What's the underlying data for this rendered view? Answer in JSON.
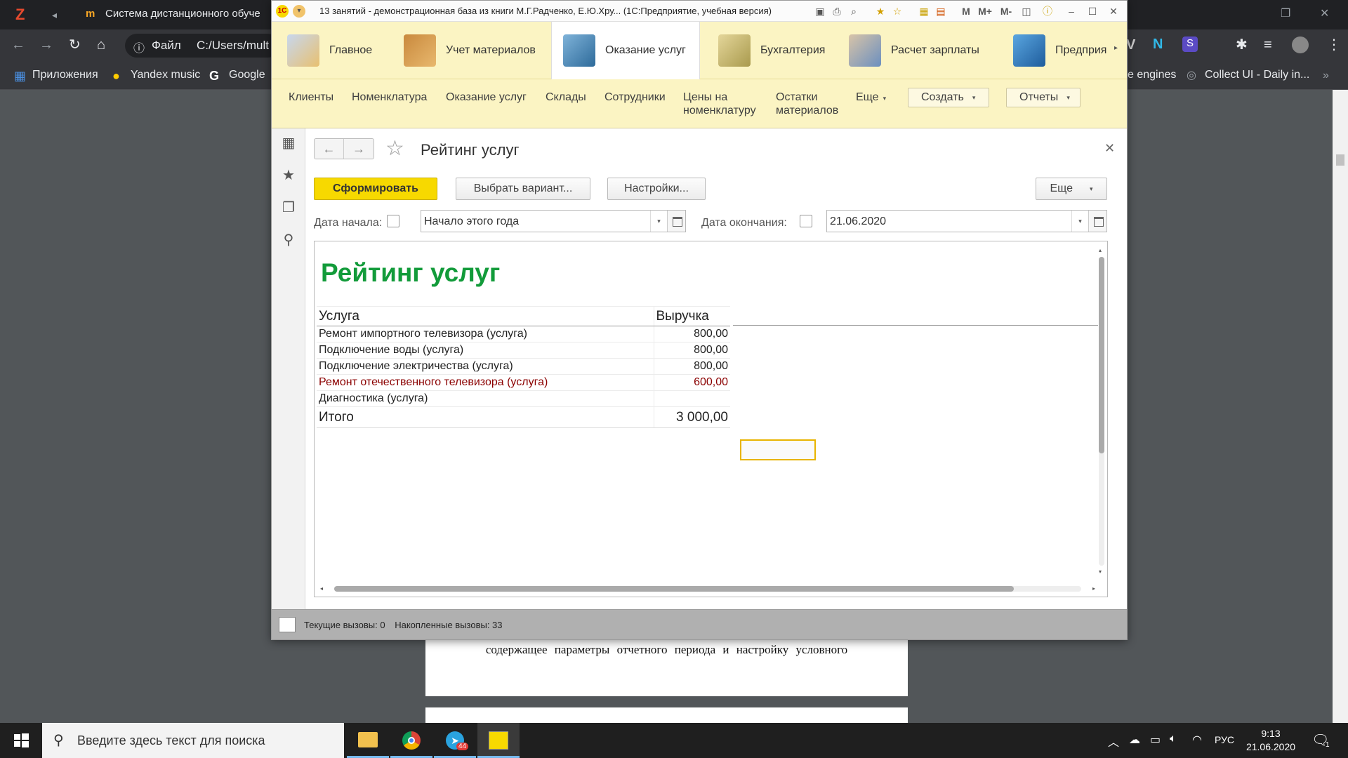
{
  "browser": {
    "tab_title": "Система дистанционного обуче",
    "address_prefix": "Файл",
    "address": "C:/Users/mult",
    "bookmarks": [
      "Приложения",
      "Yandex music",
      "Google"
    ],
    "bookmarks_right": [
      "e engines",
      "Collect UI - Daily in..."
    ]
  },
  "pdf_text": "содержащее параметры отчетного периода и настройку условного",
  "window": {
    "title": "13 занятий - демонстрационная база из книги М.Г.Радченко, Е.Ю.Хру...  (1С:Предприятие, учебная версия)",
    "title_icons": [
      "m-plus",
      "m-minus"
    ],
    "m_labels": [
      "M",
      "M+",
      "M-"
    ]
  },
  "sections": [
    {
      "label": "Главное",
      "active": false
    },
    {
      "label": "Учет материалов",
      "active": false
    },
    {
      "label": "Оказание услуг",
      "active": true
    },
    {
      "label": "Бухгалтерия",
      "active": false
    },
    {
      "label": "Расчет зарплаты",
      "active": false
    },
    {
      "label": "Предприя",
      "active": false
    }
  ],
  "commands": {
    "links": [
      "Клиенты",
      "Номенклатура",
      "Оказание услуг",
      "Склады",
      "Сотрудники"
    ],
    "prices_line1": "Цены на",
    "prices_line2": "номенклатуру",
    "rest_line1": "Остатки",
    "rest_line2": "материалов",
    "more": "Еще",
    "create": "Создать",
    "reports": "Отчеты"
  },
  "form": {
    "title": "Рейтинг услуг",
    "generate": "Сформировать",
    "choose_variant": "Выбрать вариант...",
    "settings": "Настройки...",
    "more": "Еще",
    "date_start_label": "Дата начала:",
    "date_start_value": "Начало этого года",
    "date_end_label": "Дата окончания:",
    "date_end_value": "21.06.2020"
  },
  "report": {
    "title": "Рейтинг услуг",
    "col_service": "Услуга",
    "col_revenue": "Выручка",
    "rows": [
      {
        "service": "Ремонт импортного телевизора (услуга)",
        "revenue": "800,00"
      },
      {
        "service": "Подключение воды (услуга)",
        "revenue": "800,00"
      },
      {
        "service": "Подключение электричества (услуга)",
        "revenue": "800,00"
      },
      {
        "service": "Ремонт отечественного телевизора (услуга)",
        "revenue": "600,00"
      },
      {
        "service": "Диагностика (услуга)",
        "revenue": ""
      }
    ],
    "total_label": "Итого",
    "total_value": "3 000,00"
  },
  "status": {
    "current_calls": "Текущие вызовы: 0",
    "accumulated_calls": "Накопленные вызовы: 33"
  },
  "taskbar": {
    "search_placeholder": "Введите здесь текст для поиска",
    "lang": "РУС",
    "time": "9:13",
    "date": "21.06.2020",
    "telegram_badge": "44",
    "notif_count": "1"
  },
  "colors": {
    "section_bg": "#fbf4c3",
    "report_title": "#129b3a",
    "highlight_row": "#8b0000",
    "primary_button": "#f7d900"
  }
}
